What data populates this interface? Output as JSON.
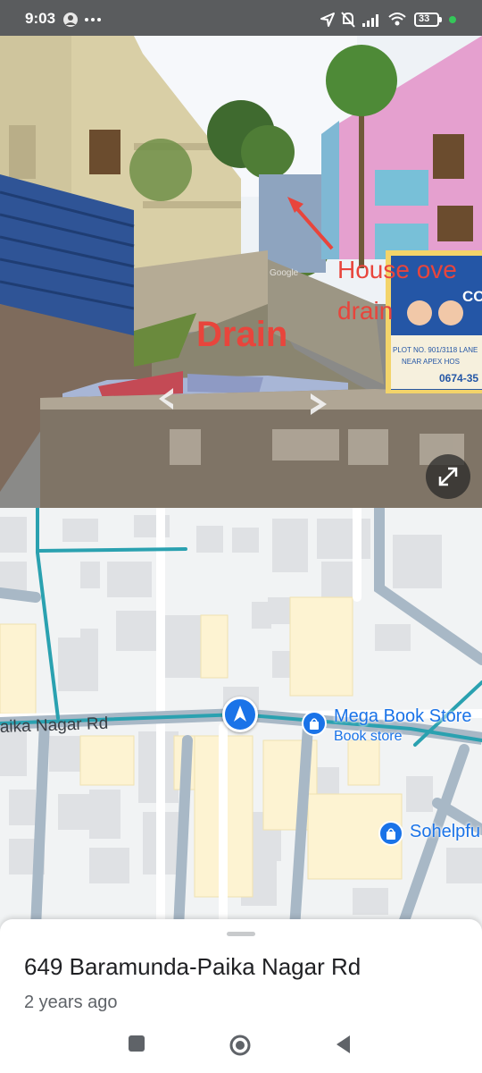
{
  "status_bar": {
    "time": "9:03",
    "battery": "33",
    "icons": [
      "user-avatar-icon",
      "more-dots-icon",
      "location-arrow-icon",
      "silent-bell-icon",
      "signal-icon",
      "wifi-icon",
      "battery-icon",
      "green-dot-icon"
    ],
    "colors": {
      "background": "#5a5c5e",
      "dot": "#34c759"
    }
  },
  "street_view": {
    "annotations": {
      "drain": "Drain",
      "house_line1": "House ove",
      "house_line2": "drain"
    },
    "sign": {
      "partial_text_1": "CO",
      "partial_text_2": "PLOT NO. 901/3118 LANE",
      "partial_text_3": "NEAR APEX HOS",
      "phone": "0674-35"
    },
    "watermark": "Google",
    "annotation_color": "#e8453c"
  },
  "map": {
    "road_label": "aika Nagar Rd",
    "pois": [
      {
        "name": "Mega Book Store",
        "category": "Book store",
        "icon": "shopping-bag-icon"
      },
      {
        "name": "Sohelpfu",
        "icon": "shopping-bag-icon"
      }
    ],
    "colors": {
      "route": "#2aa1b0",
      "poi": "#1a73e8",
      "building": "#dadce0",
      "yellow_block": "#fdf3d2"
    }
  },
  "place": {
    "address": "649 Baramunda-Paika Nagar Rd",
    "age": "2 years ago"
  },
  "nav_bar": {
    "icons": [
      "recents-square-icon",
      "home-circle-icon",
      "back-triangle-icon"
    ]
  }
}
